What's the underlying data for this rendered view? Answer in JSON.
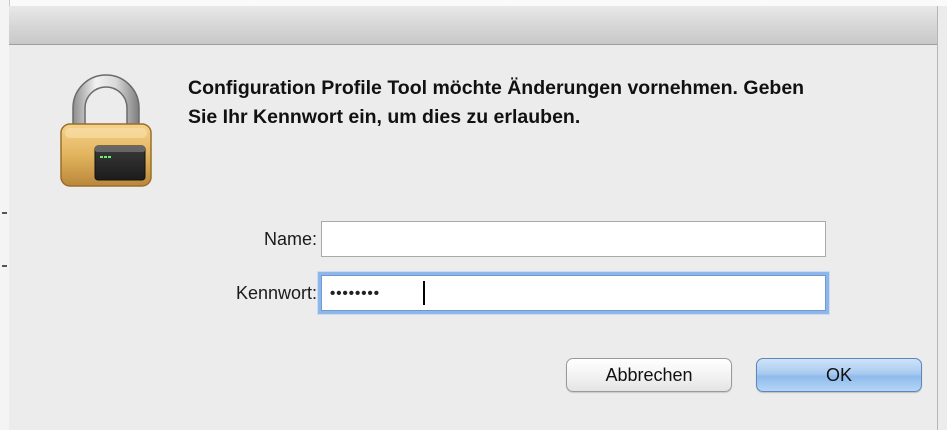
{
  "dialog": {
    "message": "Configuration Profile Tool möchte Änderungen vornehmen. Geben Sie Ihr Kennwort ein, um dies zu erlauben.",
    "icon": "lock-icon"
  },
  "form": {
    "name_label": "Name:",
    "name_value": "",
    "password_label": "Kennwort:",
    "password_value": "••••••••"
  },
  "buttons": {
    "cancel_label": "Abbrechen",
    "ok_label": "OK"
  },
  "colors": {
    "focus_ring": "#8fb6e8",
    "default_button": "#a9cbf0",
    "lock_body": "#e2b45e"
  }
}
